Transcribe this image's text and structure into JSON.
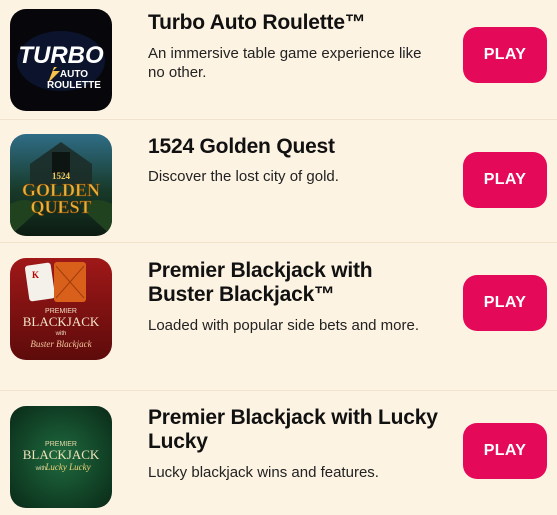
{
  "games": [
    {
      "title": "Turbo Auto Roulette™",
      "description": "An immersive table game experience like no other.",
      "play_label": "PLAY",
      "thumb_text": {
        "line1": "TURBO",
        "line2": "AUTO",
        "line3": "ROULETTE"
      }
    },
    {
      "title": "1524 Golden Quest",
      "description": "Discover the lost city of gold.",
      "play_label": "PLAY",
      "thumb_text": {
        "line1": "1524",
        "line2": "GOLDEN",
        "line3": "QUEST"
      }
    },
    {
      "title": "Premier Blackjack with Buster Blackjack™",
      "description": "Loaded with popular side bets and more.",
      "play_label": "PLAY",
      "thumb_text": {
        "line1": "PREMIER",
        "line2": "BLACKJACK",
        "line3": "with",
        "line4": "Buster Blackjack"
      }
    },
    {
      "title": "Premier Blackjack with Lucky Lucky",
      "description": "Lucky blackjack wins and features.",
      "play_label": "PLAY",
      "thumb_text": {
        "line1": "PREMIER",
        "line2": "BLACKJACK",
        "line3": "with",
        "line4": "Lucky Lucky"
      }
    }
  ],
  "colors": {
    "background": "#fdf3e3",
    "play_button": "#e5095a",
    "separator": "#f1e2cb"
  }
}
